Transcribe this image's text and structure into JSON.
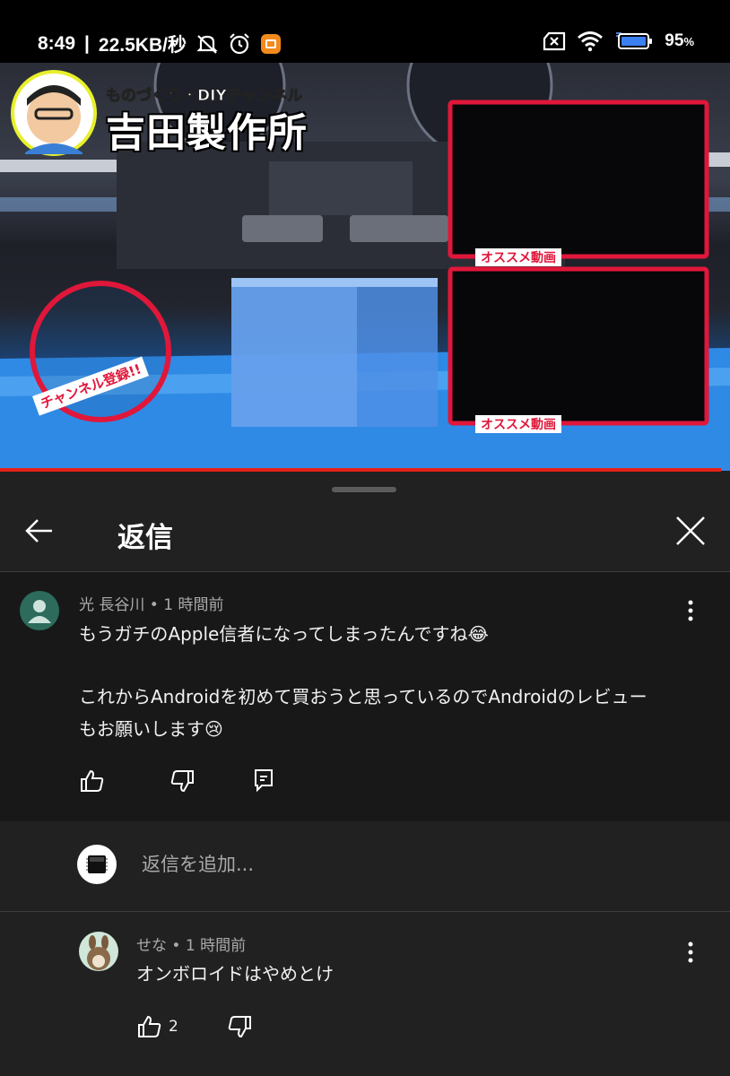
{
  "status_bar": {
    "time": "8:49",
    "network_speed": "22.5KB/秒",
    "battery": "95",
    "battery_unit": "%",
    "icons": [
      "mute-bell-icon",
      "alarm-icon",
      "notification-app-icon",
      "sim-x-icon",
      "wifi-icon",
      "battery-icon"
    ]
  },
  "video": {
    "channel_tagline": "ものづくり・DIYチャンネル",
    "channel_name": "吉田製作所",
    "recommended_label_1": "オススメ動画",
    "recommended_label_2": "オススメ動画",
    "subscribe_label": "チャンネル登録!!",
    "progress": 0.99,
    "colors": {
      "accent": "#e0173a",
      "progress": "#e62117",
      "stage_blue": "#2d7ed6"
    }
  },
  "sheet": {
    "title": "返信",
    "back_icon": "arrow-left-icon",
    "close_icon": "close-icon"
  },
  "main_comment": {
    "author": "光 長谷川",
    "separator": " • ",
    "time_ago": "1 時間前",
    "line1": "もうガチのApple信者になってしまったんですね😂",
    "line2": "これからAndroidを初めて買おうと思っているのでAndroidのレビュー",
    "line3": "もお願いします😢",
    "actions": [
      "thumbs-up-icon",
      "thumbs-down-icon",
      "reply-icon"
    ]
  },
  "reply_box": {
    "placeholder": "返信を追加..."
  },
  "replies": [
    {
      "author": "せな",
      "separator": " • ",
      "time_ago": "1 時間前",
      "text": "オンボロイドはやめとけ",
      "likes": "2"
    }
  ]
}
